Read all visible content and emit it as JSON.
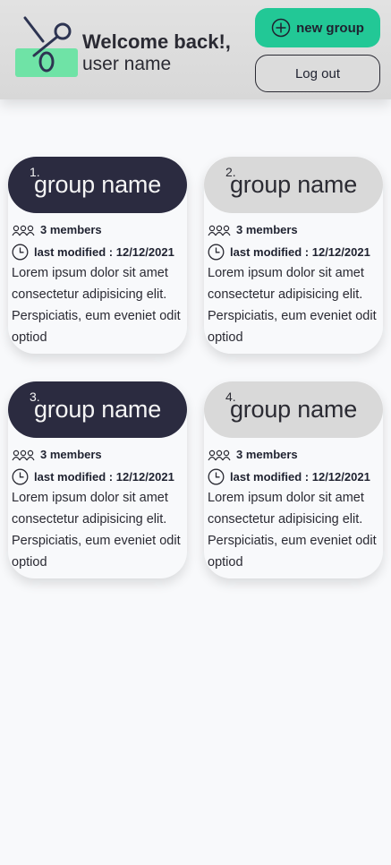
{
  "header": {
    "logo_icon": "scissors-logo-icon",
    "welcome": "Welcome back!,",
    "user_name": "user name",
    "new_group_label": "new group",
    "new_group_icon": "plus-circle-icon",
    "logout_label": "Log out",
    "accent_color": "#22c896"
  },
  "groups": [
    {
      "number": "1.",
      "name": "group name",
      "members": "3 members",
      "last_modified": "last modified : 12/12/2021",
      "description": "Lorem ipsum dolor sit amet consectetur adipisicing elit. Perspiciatis, eum eveniet odit optiod",
      "style": "dark"
    },
    {
      "number": "2.",
      "name": "group name",
      "members": "3 members",
      "last_modified": "last modified : 12/12/2021",
      "description": "Lorem ipsum dolor sit amet consectetur adipisicing elit. Perspiciatis, eum eveniet odit optiod",
      "style": "light"
    },
    {
      "number": "3.",
      "name": "group name",
      "members": "3 members",
      "last_modified": "last modified : 12/12/2021",
      "description": "Lorem ipsum dolor sit amet consectetur adipisicing elit. Perspiciatis, eum eveniet odit optiod",
      "style": "dark"
    },
    {
      "number": "4.",
      "name": "group name",
      "members": "3 members",
      "last_modified": "last modified : 12/12/2021",
      "description": "Lorem ipsum dolor sit amet consectetur adipisicing elit. Perspiciatis, eum eveniet odit optiod",
      "style": "light"
    }
  ]
}
